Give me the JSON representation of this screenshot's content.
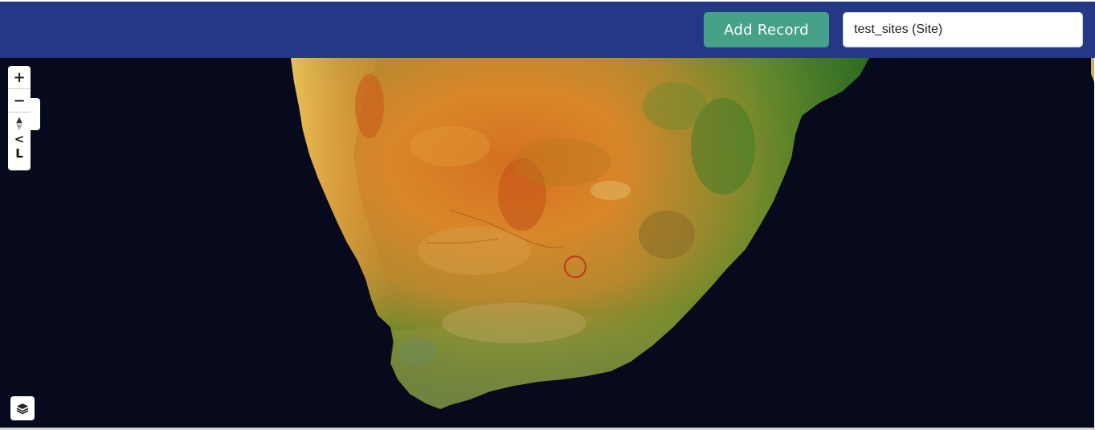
{
  "header": {
    "add_record_label": "Add Record",
    "layer_select_value": "test_sites (Site)",
    "background_color": "#243886",
    "add_button_color": "#45a289"
  },
  "map": {
    "basemap": "satellite imagery of southern Africa",
    "ocean_color": "#060a1c",
    "controls": {
      "zoom_in_label": "+",
      "zoom_out_label": "−",
      "compass_icon": "compass-icon",
      "glyph_a": "<",
      "glyph_b": "L",
      "layers_icon": "layers-icon"
    },
    "marker": {
      "shape": "circle",
      "color": "#c0361b"
    }
  }
}
